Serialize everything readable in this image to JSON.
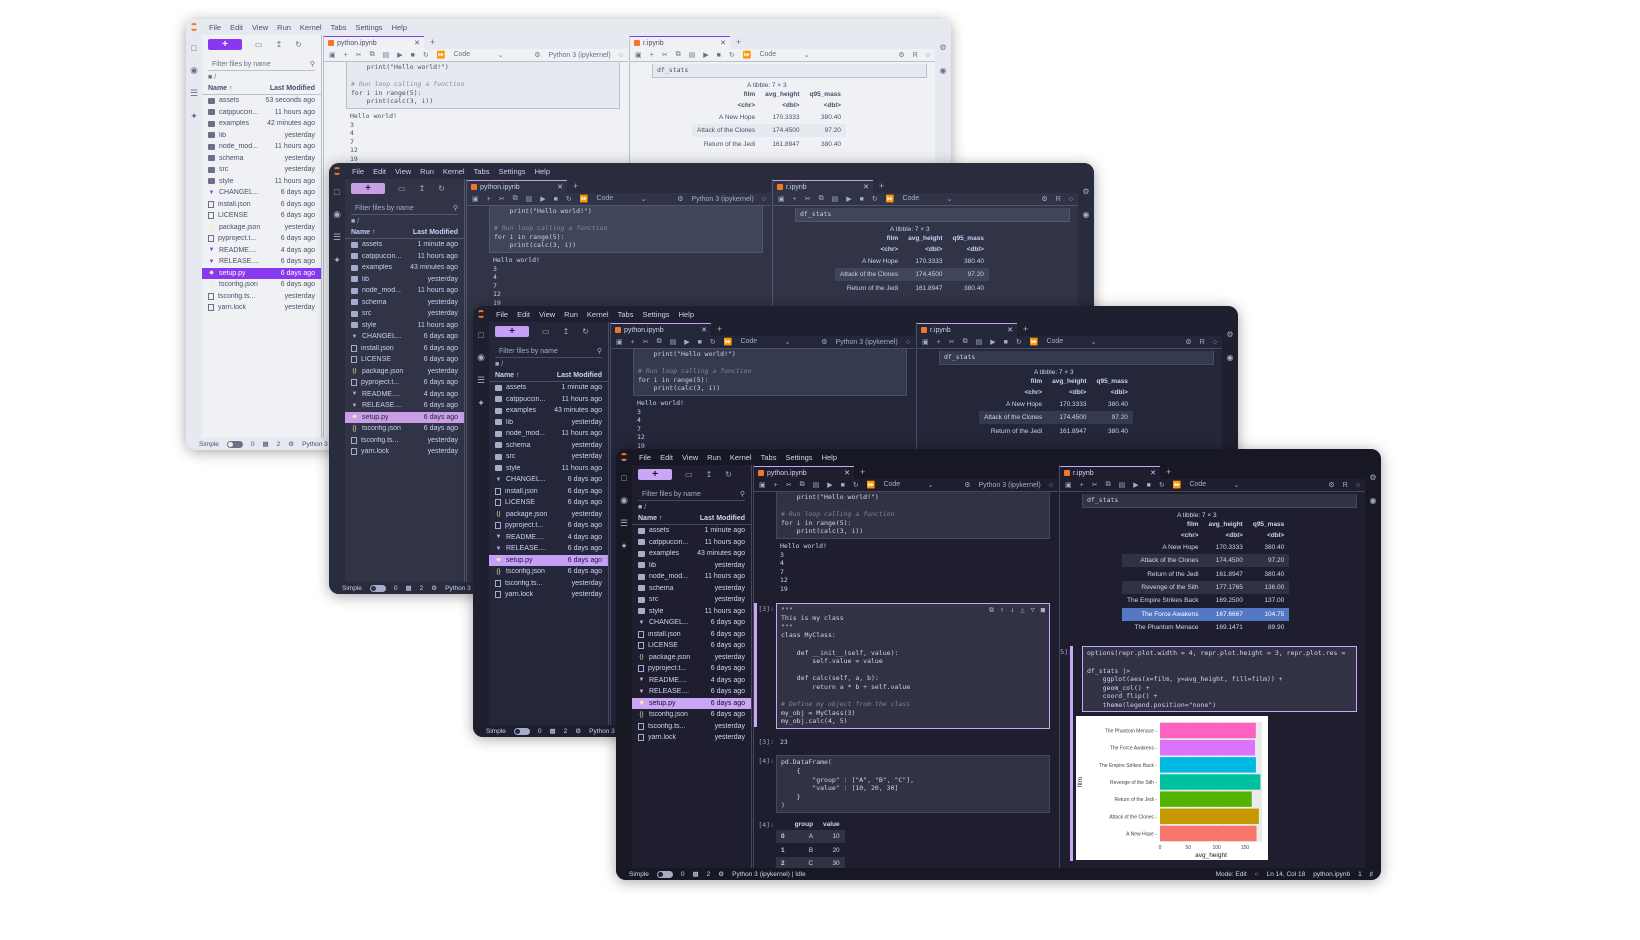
{
  "menu": [
    "File",
    "Edit",
    "View",
    "Run",
    "Kernel",
    "Tabs",
    "Settings",
    "Help"
  ],
  "filebrowser": {
    "filter_placeholder": "Filter files by name",
    "path": "/",
    "col_name": "Name",
    "col_modified": "Last Modified",
    "files_a": [
      {
        "name": "assets",
        "mod": "53 seconds ago",
        "icon": "folder"
      },
      {
        "name": "catppuccin...",
        "mod": "11 hours ago",
        "icon": "folder"
      },
      {
        "name": "examples",
        "mod": "42 minutes ago",
        "icon": "folder"
      },
      {
        "name": "lib",
        "mod": "yesterday",
        "icon": "folder"
      },
      {
        "name": "node_mod...",
        "mod": "11 hours ago",
        "icon": "folder"
      },
      {
        "name": "schema",
        "mod": "yesterday",
        "icon": "folder"
      },
      {
        "name": "src",
        "mod": "yesterday",
        "icon": "folder"
      },
      {
        "name": "style",
        "mod": "11 hours ago",
        "icon": "folder"
      },
      {
        "name": "CHANGEL...",
        "mod": "6 days ago",
        "icon": "md"
      },
      {
        "name": "install.json",
        "mod": "6 days ago",
        "icon": "file"
      },
      {
        "name": "LICENSE",
        "mod": "6 days ago",
        "icon": "file"
      },
      {
        "name": "package.json",
        "mod": "yesterday",
        "icon": "json"
      },
      {
        "name": "pyproject.t...",
        "mod": "6 days ago",
        "icon": "file"
      },
      {
        "name": "README....",
        "mod": "4 days ago",
        "icon": "md"
      },
      {
        "name": "RELEASE....",
        "mod": "6 days ago",
        "icon": "md"
      },
      {
        "name": "setup.py",
        "mod": "6 days ago",
        "icon": "py",
        "selected": true
      },
      {
        "name": "tsconfig.json",
        "mod": "6 days ago",
        "icon": "json"
      },
      {
        "name": "tsconfig.ts...",
        "mod": "yesterday",
        "icon": "file"
      },
      {
        "name": "yarn.lock",
        "mod": "yesterday",
        "icon": "file"
      }
    ],
    "files_b": [
      {
        "name": "assets",
        "mod": "1 minute ago",
        "icon": "folder"
      },
      {
        "name": "catppuccin...",
        "mod": "11 hours ago",
        "icon": "folder"
      },
      {
        "name": "examples",
        "mod": "43 minutes ago",
        "icon": "folder"
      },
      {
        "name": "lib",
        "mod": "yesterday",
        "icon": "folder"
      },
      {
        "name": "node_mod...",
        "mod": "11 hours ago",
        "icon": "folder"
      },
      {
        "name": "schema",
        "mod": "yesterday",
        "icon": "folder"
      },
      {
        "name": "src",
        "mod": "yesterday",
        "icon": "folder"
      },
      {
        "name": "style",
        "mod": "11 hours ago",
        "icon": "folder"
      },
      {
        "name": "CHANGEL...",
        "mod": "6 days ago",
        "icon": "md"
      },
      {
        "name": "install.json",
        "mod": "6 days ago",
        "icon": "file"
      },
      {
        "name": "LICENSE",
        "mod": "6 days ago",
        "icon": "file"
      },
      {
        "name": "package.json",
        "mod": "yesterday",
        "icon": "json"
      },
      {
        "name": "pyproject.t...",
        "mod": "6 days ago",
        "icon": "file"
      },
      {
        "name": "README....",
        "mod": "4 days ago",
        "icon": "md"
      },
      {
        "name": "RELEASE....",
        "mod": "6 days ago",
        "icon": "md"
      },
      {
        "name": "setup.py",
        "mod": "6 days ago",
        "icon": "py",
        "selected": true
      },
      {
        "name": "tsconfig.json",
        "mod": "6 days ago",
        "icon": "json"
      },
      {
        "name": "tsconfig.ts...",
        "mod": "yesterday",
        "icon": "file"
      },
      {
        "name": "yarn.lock",
        "mod": "yesterday",
        "icon": "file"
      }
    ]
  },
  "tabs": {
    "left": "python.ipynb",
    "right": "r.ipynb"
  },
  "toolbar": {
    "cell_type": "Code",
    "kernel_py": "Python 3 (ipykernel)",
    "kernel_r": "R"
  },
  "python_cells": {
    "print_line": "    print(\"Hello world!\")",
    "comment_loop": "# Run loop calling a function",
    "for_line": "for i in range(5):",
    "calc_line": "    print(calc(3, i))",
    "output_lines": [
      "Hello world!",
      "3",
      "4",
      "7",
      "12",
      "19"
    ],
    "prompt3": "[3]:",
    "class_code": [
      "\"\"\"",
      "This is my class",
      "\"\"\"",
      "class MyClass:",
      "",
      "    def __init__(self, value):",
      "        self.value = value",
      "",
      "    def calc(self, a, b):",
      "        return a * b + self.value",
      "",
      "# Define my object from the class",
      "my_obj = MyClass(3)",
      "my_obj.calc(4, 5)"
    ],
    "out3": "23",
    "prompt4": "[4]:",
    "df_code": [
      "pd.DataFrame(",
      "    {",
      "        \"group\" : [\"A\", \"B\", \"C\"],",
      "        \"value\" : [10, 20, 30]",
      "    }",
      ")"
    ],
    "df_header": [
      "",
      "group",
      "value"
    ],
    "df_rows": [
      [
        "0",
        "A",
        "10"
      ],
      [
        "1",
        "B",
        "20"
      ],
      [
        "2",
        "C",
        "30"
      ]
    ]
  },
  "r_cells": {
    "df_stats": "df_stats",
    "caption": "A tibble: 7 × 3",
    "headers": [
      "film",
      "avg_height",
      "q95_mass"
    ],
    "types": [
      "<chr>",
      "<dbl>",
      "<dbl>"
    ],
    "rows": [
      [
        "A New Hope",
        "170.3333",
        "380.40"
      ],
      [
        "Attack of the Clones",
        "174.4500",
        "97.20"
      ],
      [
        "Return of the Jedi",
        "161.8947",
        "380.40"
      ],
      [
        "Revenge of the Sith",
        "177.1765",
        "136.00"
      ],
      [
        "The Empire Strikes Back",
        "169.2500",
        "137.00"
      ],
      [
        "The Force Awakens",
        "167.6667",
        "104.75"
      ],
      [
        "The Phantom Menace",
        "169.1471",
        "89.90"
      ]
    ],
    "prompt5": "[5]:",
    "plot_code": [
      "options(repr.plot.width = 4, repr.plot.height = 3, repr.plot.res =",
      "",
      "df_stats |>",
      "    ggplot(aes(x=film, y=avg_height, fill=film)) +",
      "    geom_col() +",
      "    coord_flip() +",
      "    theme(legend.position=\"none\")"
    ]
  },
  "chart_data": {
    "type": "bar",
    "orientation": "horizontal",
    "categories": [
      "The Phantom Menace",
      "The Force Awakens",
      "The Empire Strikes Back",
      "Revenge of the Sith",
      "Return of the Jedi",
      "Attack of the Clones",
      "A New Hope"
    ],
    "values": [
      169.1471,
      167.6667,
      169.25,
      177.1765,
      161.8947,
      174.45,
      170.3333
    ],
    "colors": [
      "#ff61c3",
      "#db72fb",
      "#00b9e3",
      "#00c19f",
      "#53b400",
      "#c49a00",
      "#f8766d"
    ],
    "xlabel": "avg_height",
    "ylabel": "film",
    "ticks": [
      "0",
      "50",
      "100",
      "150"
    ],
    "xlim": [
      0,
      180
    ]
  },
  "status": {
    "simple": "Simple",
    "zero": "0",
    "two": "2",
    "kernel": "Python 3 (ipykernel) | Idle",
    "kernel_short": "Python 3 (ipy",
    "mode": "Mode: Edit",
    "position": "Ln 14, Col 18",
    "file": "python.ipynb",
    "one": "1"
  },
  "icons": {
    "new": "+",
    "folder": "folder-icon",
    "upload": "upload-icon",
    "refresh": "refresh-icon"
  }
}
